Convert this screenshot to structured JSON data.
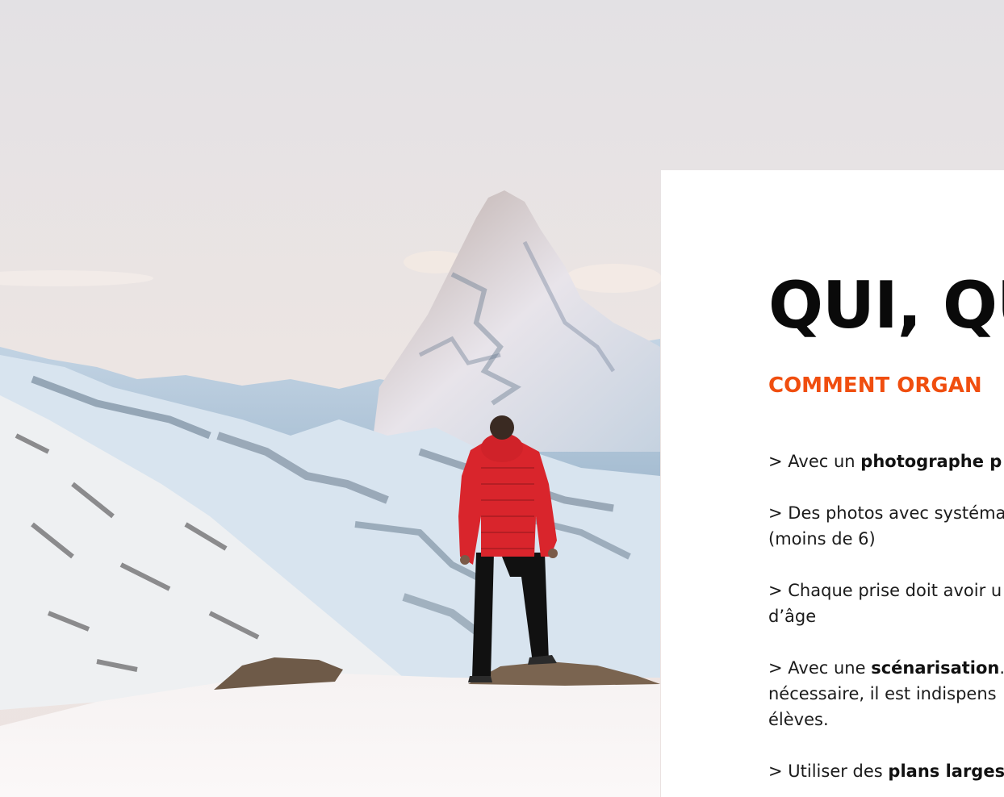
{
  "hero": {
    "subject": "mountain-hiker-photo"
  },
  "content": {
    "title": "QUI, QU",
    "subtitle": "COMMENT ORGAN",
    "bullets": [
      {
        "prefix": "> Avec un ",
        "bold": "photographe p",
        "suffix": ""
      },
      {
        "prefix": "> Des photos avec systéma",
        "bold": "",
        "suffix": "",
        "line2": "(moins de 6)"
      },
      {
        "prefix": "> Chaque prise doit avoir u",
        "bold": "",
        "suffix": "",
        "line2": "d’âge"
      },
      {
        "prefix": "> Avec une ",
        "bold": "scénarisation",
        "suffix": ".",
        "line2": "nécessaire, il est indispens",
        "line3": "élèves."
      },
      {
        "prefix": "> Utiliser des ",
        "bold": "plans larges",
        "suffix": ""
      }
    ]
  },
  "colors": {
    "accent": "#f04e0f",
    "title": "#0a0a0a",
    "jacket": "#d9252c",
    "sky": "#e8e3e2"
  }
}
